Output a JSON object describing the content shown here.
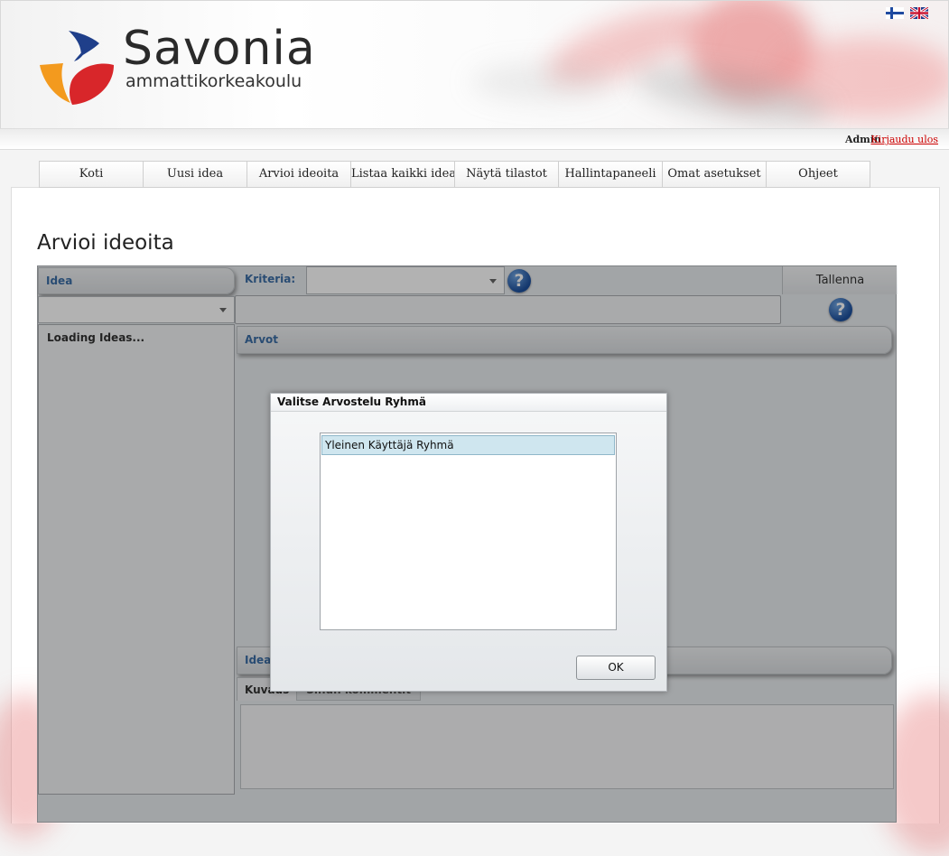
{
  "brand": {
    "name": "Savonia",
    "subtitle": "ammattikorkeakoulu",
    "colors": {
      "orange": "#f39a1e",
      "red": "#d8262a",
      "blue": "#1f3f8a"
    }
  },
  "languages": [
    {
      "icon": "finnish-flag-icon"
    },
    {
      "icon": "uk-flag-icon"
    }
  ],
  "user": {
    "name": "Admin",
    "logout": "Kirjaudu ulos"
  },
  "nav": [
    {
      "label": "Koti"
    },
    {
      "label": "Uusi idea"
    },
    {
      "label": "Arvioi ideoita"
    },
    {
      "label": "Listaa kaikki ideat"
    },
    {
      "label": "Näytä tilastot"
    },
    {
      "label": "Hallintapaneeli"
    },
    {
      "label": "Omat asetukset"
    },
    {
      "label": "Ohjeet"
    }
  ],
  "page": {
    "title": "Arvioi ideoita"
  },
  "app": {
    "idea_header": "Idea",
    "criteria_label": "Kriteria:",
    "save_label": "Tallenna",
    "loading": "Loading Ideas...",
    "values_header": "Arvot",
    "idea_detail_label": "Idea:",
    "tabs": [
      {
        "label": "Kuvaus"
      },
      {
        "label": "Sinun kommentit"
      }
    ],
    "help_icon": "?"
  },
  "dialog": {
    "title": "Valitse Arvostelu Ryhmä",
    "items": [
      "Yleinen Käyttäjä Ryhmä"
    ],
    "ok_label": "OK"
  }
}
